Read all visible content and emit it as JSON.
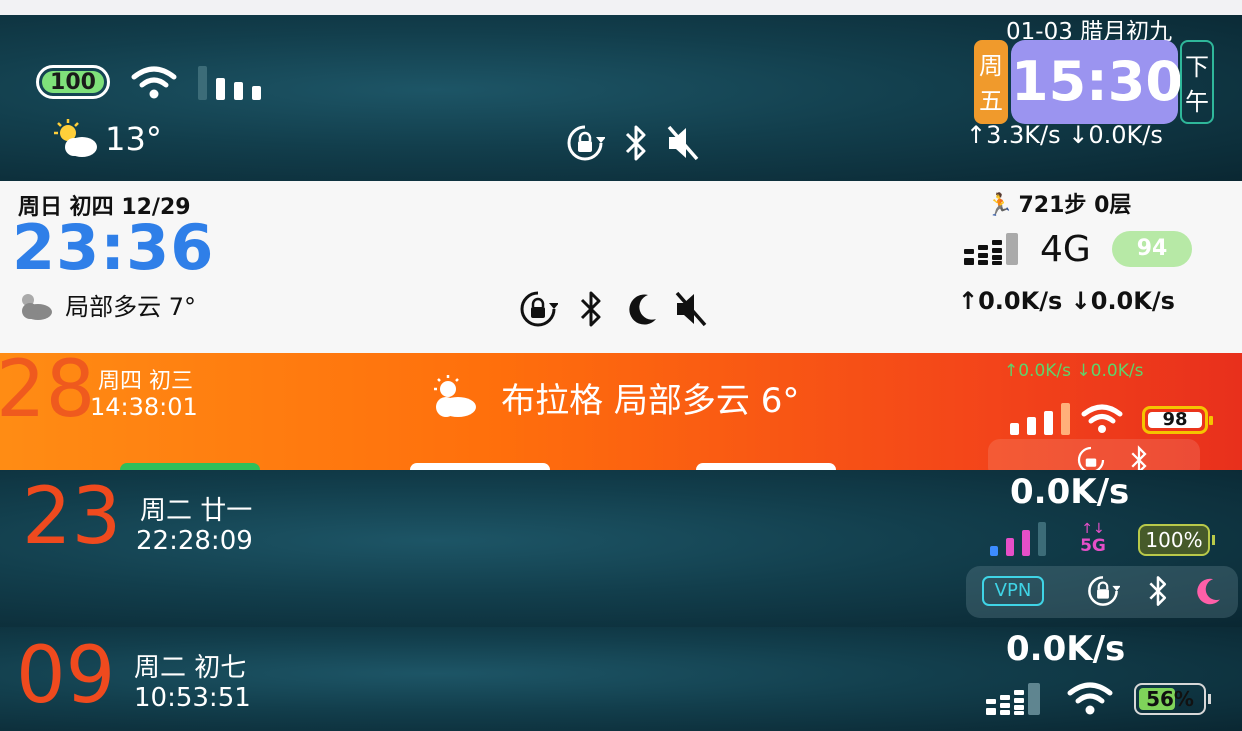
{
  "row1": {
    "battery": "100",
    "temperature": "13°",
    "date_lunar": "01-03 腊月初九",
    "weekday_1": "周",
    "weekday_2": "五",
    "time": "15:30",
    "ampm_1": "下",
    "ampm_2": "午",
    "net_speed": "↑3.3K/s ↓0.0K/s",
    "colors": {
      "weekday_bg": "#f09a2c",
      "time_bg": "#9b94f0",
      "ampm_border": "#2fb79a"
    }
  },
  "row2": {
    "date": "周日 初四 12/29",
    "time": "23:36",
    "weather": "局部多云 7°",
    "steps": "721步 0层",
    "network": "4G",
    "battery": "94",
    "net_speed": "↑0.0K/s ↓0.0K/s",
    "colors": {
      "time": "#2f7fe8",
      "battery_bg": "#b7e9a6"
    }
  },
  "row3": {
    "day": "28",
    "weekday_lunar": "周四 初三",
    "clock": "14:38:01",
    "weather": "布拉格 局部多云 6°",
    "net_speed": "↑0.0K/s ↓0.0K/s",
    "battery": "98",
    "colors": {
      "day": "#ef5a1e",
      "net_speed": "#5fd36a",
      "battery_border": "#f5c400"
    }
  },
  "row4": {
    "day": "23",
    "weekday_lunar": "周二 廿一",
    "clock": "22:28:09",
    "net_speed": "0.0K/s",
    "network": "5G",
    "battery": "100%",
    "vpn": "VPN",
    "colors": {
      "day": "#ef4a1e",
      "network": "#e64fc8",
      "vpn": "#3fd4e6",
      "moon": "#ff5fa8"
    }
  },
  "row5": {
    "day": "09",
    "weekday_lunar": "周二 初七",
    "clock": "10:53:51",
    "net_speed": "0.0K/s",
    "battery": "56%",
    "colors": {
      "day": "#ef4a1e",
      "battery_fill": "#7fd35a"
    }
  }
}
